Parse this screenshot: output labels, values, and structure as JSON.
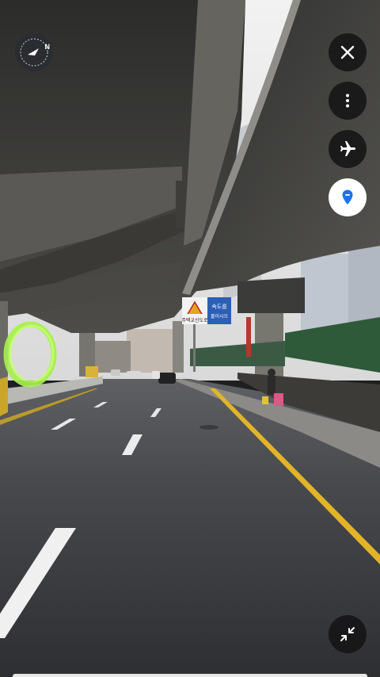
{
  "scene": {
    "sign_left_text": "주택교신도로",
    "sign_right_line1": "속도를",
    "sign_right_line2": "줄이시오"
  },
  "controls": {
    "compass": {
      "label": "N",
      "icon": "compass-icon"
    },
    "close": {
      "icon": "close-icon"
    },
    "more": {
      "icon": "more-vert-icon"
    },
    "airplane": {
      "icon": "airplane-icon"
    },
    "location": {
      "icon": "location-pin-icon",
      "color": "#1a73e8"
    },
    "collapse": {
      "icon": "collapse-icon"
    }
  },
  "colors": {
    "annotation_circle": "#a6f04f",
    "lane_yellow": "#e2b428"
  }
}
